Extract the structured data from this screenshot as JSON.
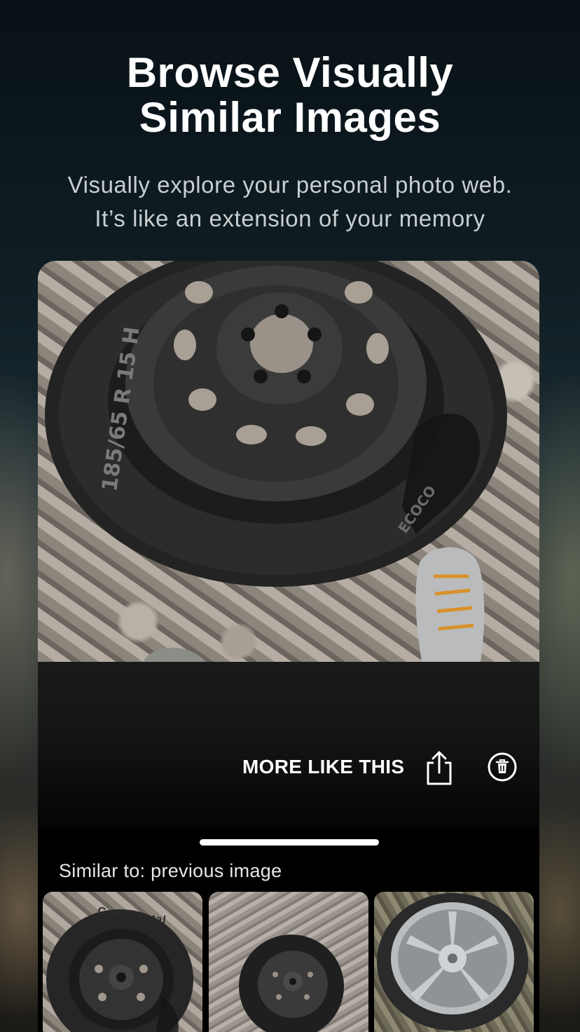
{
  "header": {
    "title": "Browse Visually\nSimilar Images",
    "subtitle": "Visually explore your personal photo web.\nIt’s like an extension of your memory"
  },
  "main_photo": {
    "tire_size_text": "185/65 R 15 H",
    "tire_brand_text": "ECOCO"
  },
  "actions": {
    "more_like_this_label": "MORE LIKE THIS",
    "share_icon": "share-icon",
    "delete_icon": "trash-icon"
  },
  "similar": {
    "label": "Similar to: previous image",
    "thumbnails": [
      {
        "subject": "steel wheel tire on gravel",
        "brand_text": "Continental"
      },
      {
        "subject": "steel wheel tire on gravel"
      },
      {
        "subject": "alloy wheel tire on grass"
      }
    ]
  },
  "colors": {
    "background_top": "#081116",
    "accent_text": "#ffffff",
    "subtitle_text": "#c9cfd0"
  }
}
